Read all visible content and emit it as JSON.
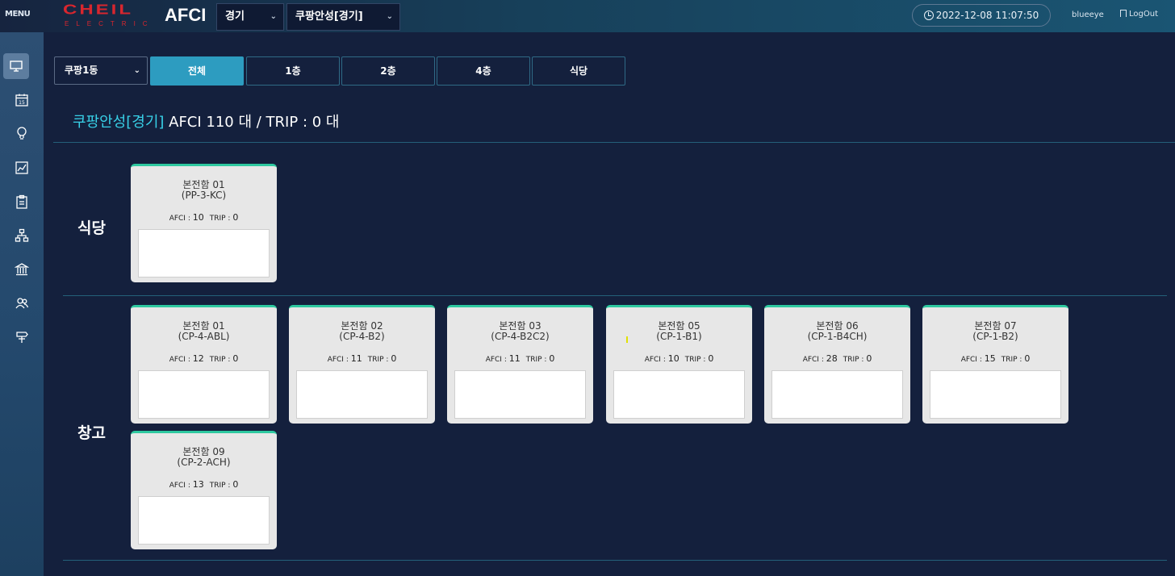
{
  "header": {
    "menu_label": "MENU",
    "logo_main": "CHEIL",
    "logo_sub": "ELECTRIC",
    "logo_color": "#d8262e",
    "app_title": "AFCI",
    "region_select": "경기",
    "site_select": "쿠팡안성[경기]",
    "datetime": "2022-12-08 11:07:50",
    "user": "blueeye",
    "logout_label": "LogOut"
  },
  "sidebar": {
    "items": [
      {
        "icon": "monitor-icon",
        "active": true
      },
      {
        "icon": "calendar-icon"
      },
      {
        "icon": "lightbulb-icon"
      },
      {
        "icon": "chart-icon"
      },
      {
        "icon": "clipboard-icon"
      },
      {
        "icon": "network-icon"
      },
      {
        "icon": "bank-icon"
      },
      {
        "icon": "users-icon"
      },
      {
        "icon": "signpost-icon"
      }
    ]
  },
  "filters": {
    "building": "쿠팡1동",
    "tabs": [
      "전체",
      "1층",
      "2층",
      "4층",
      "식당"
    ],
    "active_tab": "전체",
    "accent": "#2d9cc0"
  },
  "summary": {
    "site": "쿠팡안성[경기]",
    "text": "AFCI 110 대 / TRIP : 0 대",
    "site_color": "#38d1e8"
  },
  "sections": [
    {
      "label": "식당",
      "cards": [
        {
          "name": "본전함 01",
          "code": "(PP-3-KC)",
          "afci": "10",
          "trip": "0"
        }
      ]
    },
    {
      "label": "창고",
      "cards": [
        {
          "name": "본전함 01",
          "code": "(CP-4-ABL)",
          "afci": "12",
          "trip": "0"
        },
        {
          "name": "본전함 02",
          "code": "(CP-4-B2)",
          "afci": "11",
          "trip": "0"
        },
        {
          "name": "본전함 03",
          "code": "(CP-4-B2C2)",
          "afci": "11",
          "trip": "0"
        },
        {
          "name": "본전함 05",
          "code": "(CP-1-B1)",
          "afci": "10",
          "trip": "0"
        },
        {
          "name": "본전함 06",
          "code": "(CP-1-B4CH)",
          "afci": "28",
          "trip": "0"
        },
        {
          "name": "본전함 07",
          "code": "(CP-1-B2)",
          "afci": "15",
          "trip": "0"
        },
        {
          "name": "본전함 09",
          "code": "(CP-2-ACH)",
          "afci": "13",
          "trip": "0"
        }
      ]
    }
  ],
  "labels": {
    "afci_prefix": "AFCI : ",
    "trip_prefix": "TRIP : "
  }
}
